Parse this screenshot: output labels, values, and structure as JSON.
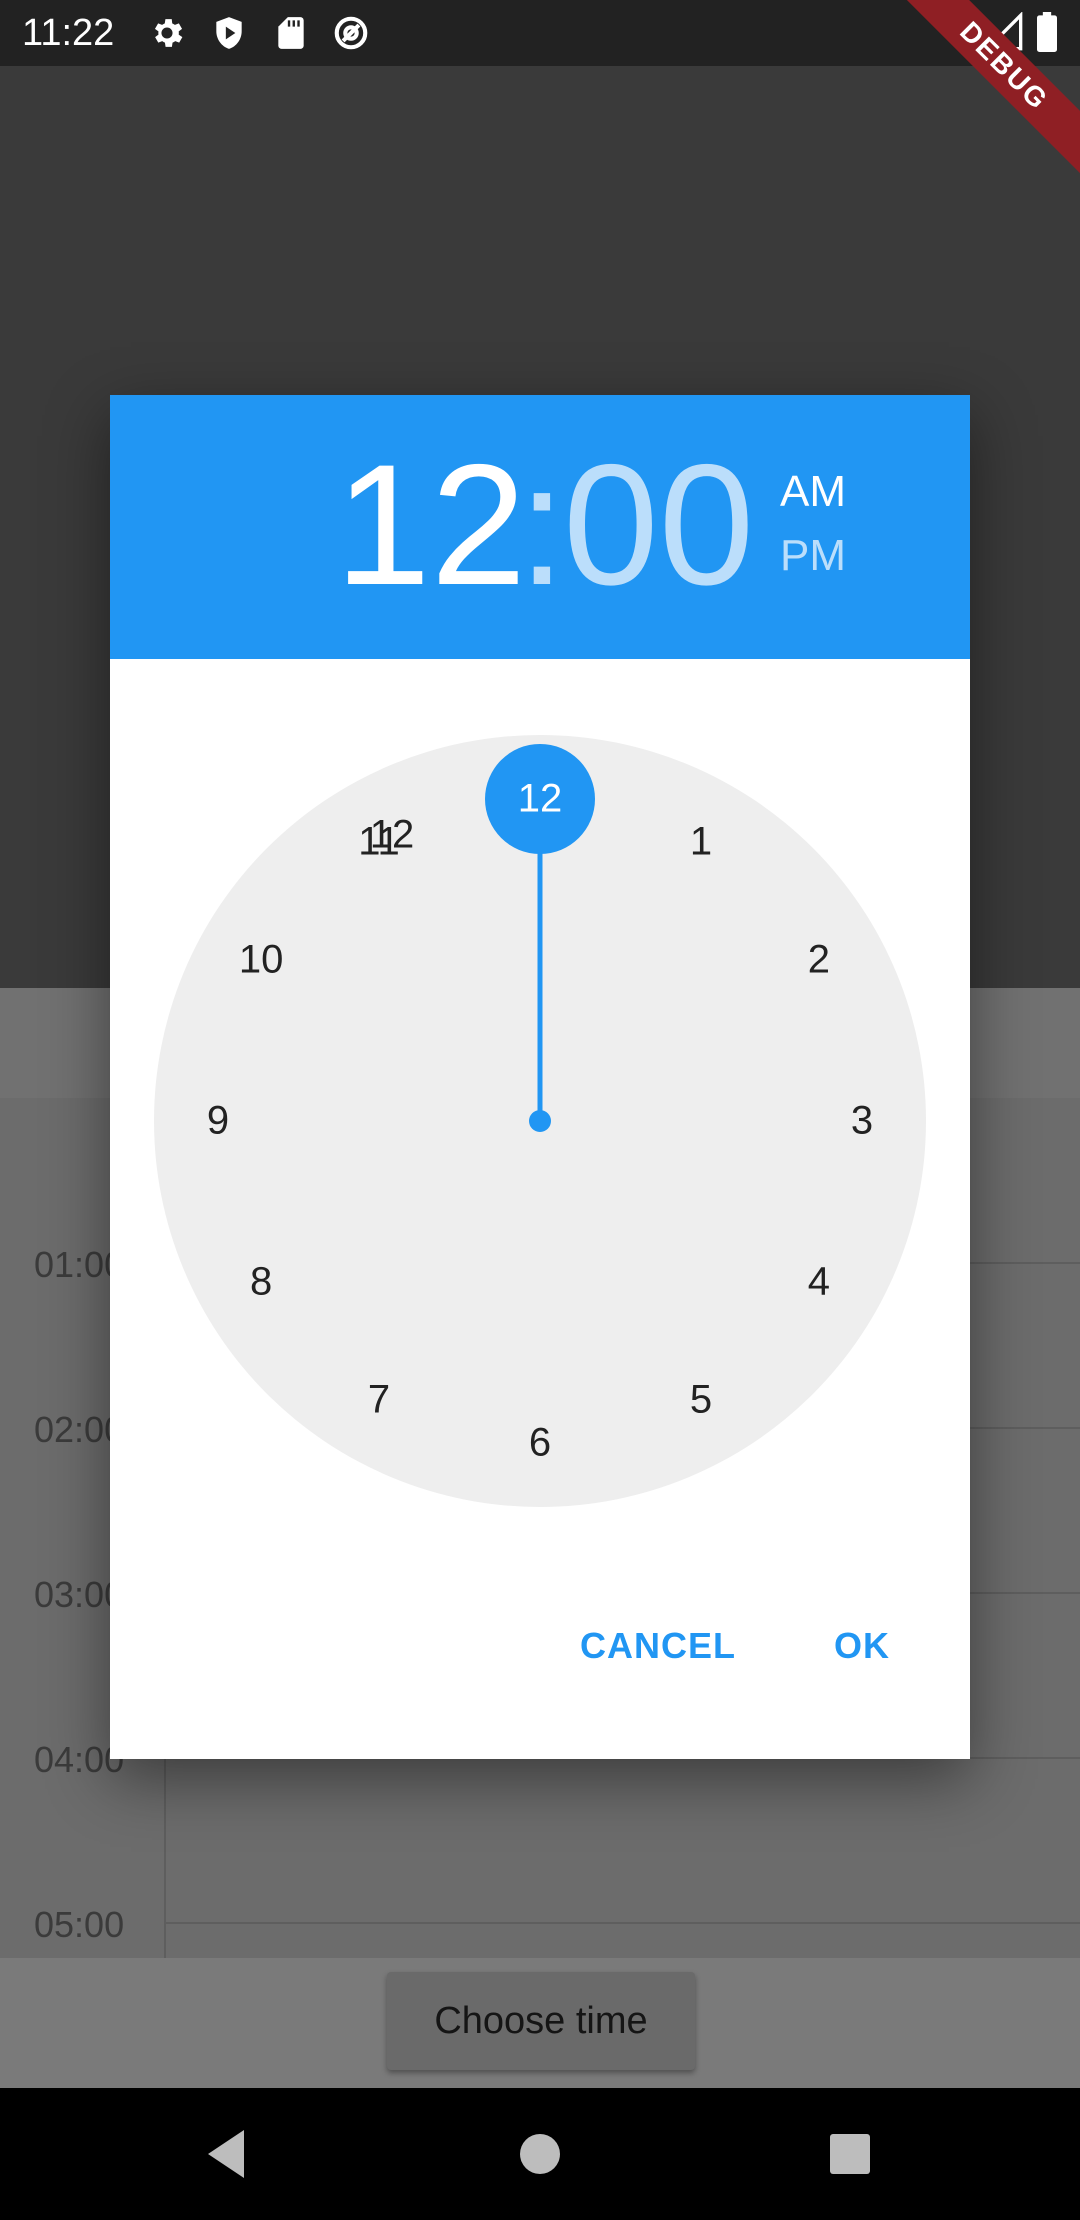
{
  "status_bar": {
    "time": "11:22",
    "icons": [
      "settings-icon",
      "shield-icon",
      "sd-card-icon",
      "at-sign-icon",
      "wifi-icon",
      "signal-icon",
      "battery-icon"
    ]
  },
  "debug_banner": "DEBUG",
  "schedule": {
    "hours": [
      "01:00",
      "02:00",
      "03:00",
      "04:00",
      "05:00"
    ]
  },
  "choose_time_button": "Choose time",
  "dialog": {
    "header": {
      "hour": "12",
      "separator": ":",
      "minute": "00",
      "am": "AM",
      "pm": "PM"
    },
    "dial_numbers": [
      "12",
      "1",
      "2",
      "3",
      "4",
      "5",
      "6",
      "7",
      "8",
      "9",
      "10",
      "11"
    ],
    "selected_hour": "12",
    "cancel_label": "CANCEL",
    "ok_label": "OK"
  },
  "colors": {
    "accent": "#2196f3",
    "accent_light": "#bbdefb",
    "dial_face": "#eeeeee"
  }
}
